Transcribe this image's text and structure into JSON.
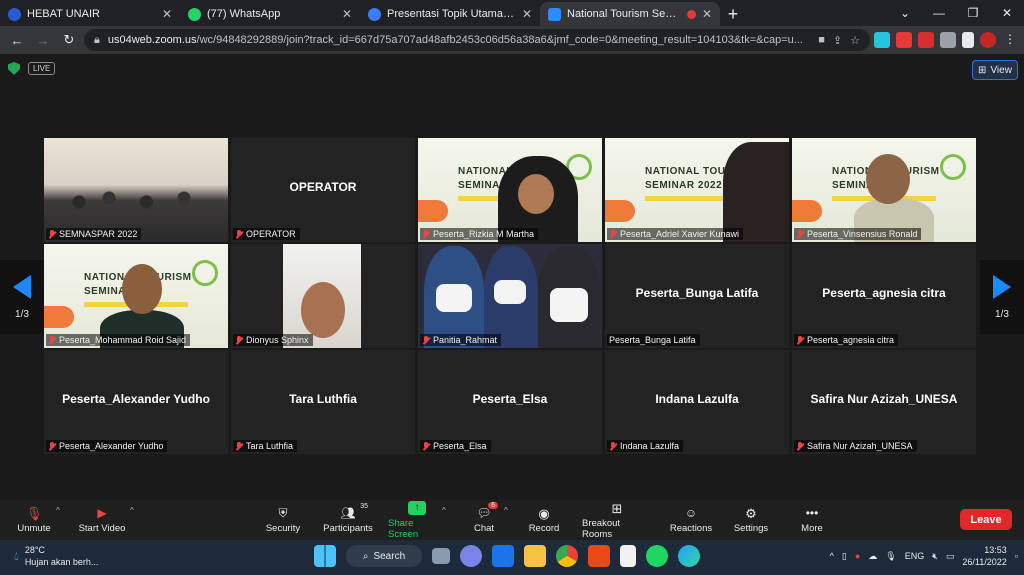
{
  "browser": {
    "tabs": [
      {
        "title": "HEBAT UNAIR",
        "color": "#2a5bd7"
      },
      {
        "title": "(77) WhatsApp",
        "color": "#25d366"
      },
      {
        "title": "Presentasi Topik Utama Webinar",
        "color": "#3d7bfd"
      },
      {
        "title": "National Tourism Seminar",
        "color": "#2d8cff"
      }
    ],
    "url_host": "us04web.zoom.us",
    "url_path": "/wc/94848292889/join?track_id=667d75a707ad48afb2453c06d56a38a6&jmf_code=0&meeting_result=104103&tk=&cap=u..."
  },
  "zoom": {
    "live_label": "LIVE",
    "view_label": "View",
    "page_indicator": "1/3",
    "tiles": [
      {
        "label": "SEMNASPAR 2022",
        "big": "",
        "kind": "group"
      },
      {
        "label": "OPERATOR",
        "big": "OPERATOR",
        "kind": "name"
      },
      {
        "label": "Peserta_Rizkia M Martha",
        "big": "",
        "kind": "slide-hijab"
      },
      {
        "label": "Peserta_Adriel Xavier Kunawi",
        "big": "",
        "kind": "slide-side"
      },
      {
        "label": "Peserta_Vinsensius Ronald",
        "big": "",
        "kind": "slide-face"
      },
      {
        "label": "Peserta_Mohammad Roid Sajid",
        "big": "",
        "kind": "slide-face2"
      },
      {
        "label": "Dionyus Sphinx",
        "big": "",
        "kind": "selfie"
      },
      {
        "label": "Panitia_Rahmat",
        "big": "",
        "kind": "masks"
      },
      {
        "label": "Peserta_Bunga Latifa",
        "big": "Peserta_Bunga Latifa",
        "kind": "name"
      },
      {
        "label": "Peserta_agnesia citra",
        "big": "Peserta_agnesia citra",
        "kind": "name"
      },
      {
        "label": "Peserta_Alexander Yudho",
        "big": "Peserta_Alexander Yudho",
        "kind": "name"
      },
      {
        "label": "Tara Luthfia",
        "big": "Tara Luthfia",
        "kind": "name"
      },
      {
        "label": "Peserta_Elsa",
        "big": "Peserta_Elsa",
        "kind": "name"
      },
      {
        "label": "Indana Lazulfa",
        "big": "Indana Lazulfa",
        "kind": "name"
      },
      {
        "label": "Safira Nur Azizah_UNESA",
        "big": "Safira Nur Azizah_UNESA",
        "kind": "name"
      }
    ],
    "slide_title_1": "NATIONAL TOURISM",
    "slide_title_2": "SEMINAR 2022",
    "toolbar": {
      "unmute": "Unmute",
      "start_video": "Start Video",
      "security": "Security",
      "participants": "Participants",
      "participants_count": "35",
      "share_screen": "Share Screen",
      "chat": "Chat",
      "chat_badge": "6",
      "record": "Record",
      "breakout": "Breakout Rooms",
      "reactions": "Reactions",
      "settings": "Settings",
      "more": "More",
      "leave": "Leave"
    }
  },
  "taskbar": {
    "temperature": "28°C",
    "weather_text": "Hujan akan berh...",
    "search": "Search",
    "lang": "ENG",
    "time": "13:53",
    "date": "26/11/2022"
  }
}
